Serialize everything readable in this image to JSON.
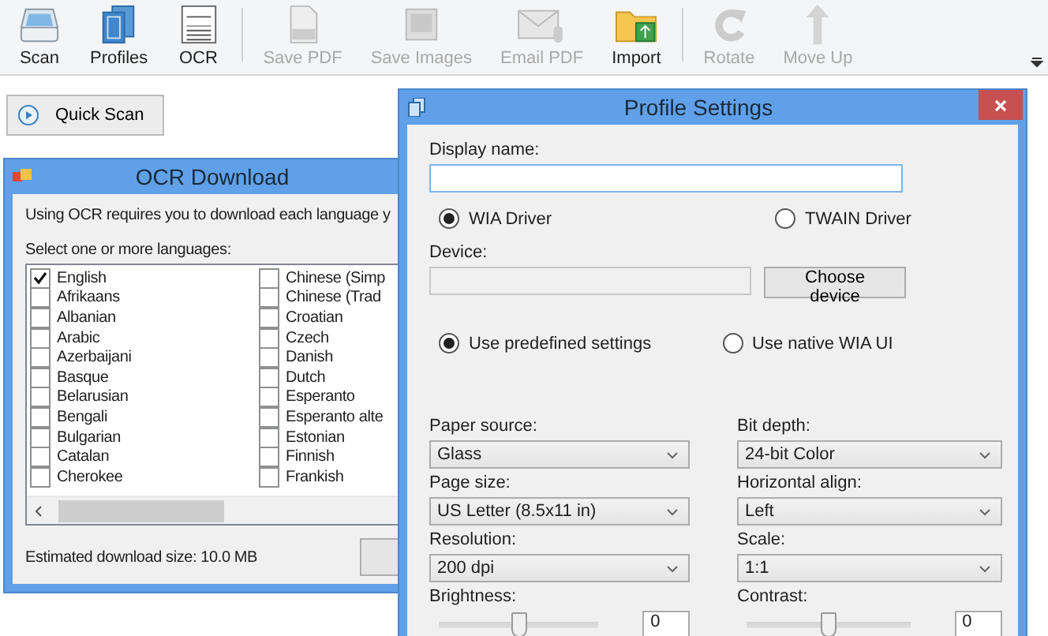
{
  "toolbar": {
    "groups": [
      [
        {
          "label": "Scan",
          "disabled": false
        },
        {
          "label": "Profiles",
          "disabled": false
        },
        {
          "label": "OCR",
          "disabled": false
        }
      ],
      [
        {
          "label": "Save PDF",
          "disabled": true
        },
        {
          "label": "Save Images",
          "disabled": true
        },
        {
          "label": "Email PDF",
          "disabled": true
        },
        {
          "label": "Import",
          "disabled": false
        }
      ],
      [
        {
          "label": "Rotate",
          "disabled": true
        },
        {
          "label": "Move Up",
          "disabled": true
        }
      ]
    ]
  },
  "quick_scan": {
    "label": "Quick Scan"
  },
  "ocr_window": {
    "title": "OCR Download",
    "message": "Using OCR requires you to download each language y",
    "prompt": "Select one or more languages:",
    "languages": [
      [
        {
          "label": "English",
          "checked": true
        },
        {
          "label": "Afrikaans",
          "checked": false
        },
        {
          "label": "Albanian",
          "checked": false
        },
        {
          "label": "Arabic",
          "checked": false
        },
        {
          "label": "Azerbaijani",
          "checked": false
        },
        {
          "label": "Basque",
          "checked": false
        },
        {
          "label": "Belarusian",
          "checked": false
        },
        {
          "label": "Bengali",
          "checked": false
        },
        {
          "label": "Bulgarian",
          "checked": false
        },
        {
          "label": "Catalan",
          "checked": false
        },
        {
          "label": "Cherokee",
          "checked": false
        }
      ],
      [
        {
          "label": "Chinese (Simp",
          "checked": false
        },
        {
          "label": "Chinese (Trad",
          "checked": false
        },
        {
          "label": "Croatian",
          "checked": false
        },
        {
          "label": "Czech",
          "checked": false
        },
        {
          "label": "Danish",
          "checked": false
        },
        {
          "label": "Dutch",
          "checked": false
        },
        {
          "label": "Esperanto",
          "checked": false
        },
        {
          "label": "Esperanto alte",
          "checked": false
        },
        {
          "label": "Estonian",
          "checked": false
        },
        {
          "label": "Finnish",
          "checked": false
        },
        {
          "label": "Frankish",
          "checked": false
        }
      ]
    ],
    "estimate": "Estimated download size: 10.0 MB"
  },
  "profile_window": {
    "title": "Profile Settings",
    "display_name_label": "Display name:",
    "drivers": [
      {
        "label": "WIA Driver",
        "selected": true
      },
      {
        "label": "TWAIN Driver",
        "selected": false
      }
    ],
    "device_label": "Device:",
    "choose_button": "Choose device",
    "modes": [
      {
        "label": "Use predefined settings",
        "selected": true
      },
      {
        "label": "Use native WIA UI",
        "selected": false
      }
    ],
    "selects": [
      [
        {
          "label": "Paper source:",
          "value": "Glass"
        },
        {
          "label": "Page size:",
          "value": "US Letter (8.5x11 in)"
        },
        {
          "label": "Resolution:",
          "value": "200 dpi"
        }
      ],
      [
        {
          "label": "Bit depth:",
          "value": "24-bit Color"
        },
        {
          "label": "Horizontal align:",
          "value": "Left"
        },
        {
          "label": "Scale:",
          "value": "1:1"
        }
      ]
    ],
    "sliders": [
      {
        "label": "Brightness:",
        "level": 0.5,
        "value": "0"
      },
      {
        "label": "Contrast:",
        "level": 0.5,
        "value": "0"
      }
    ]
  }
}
